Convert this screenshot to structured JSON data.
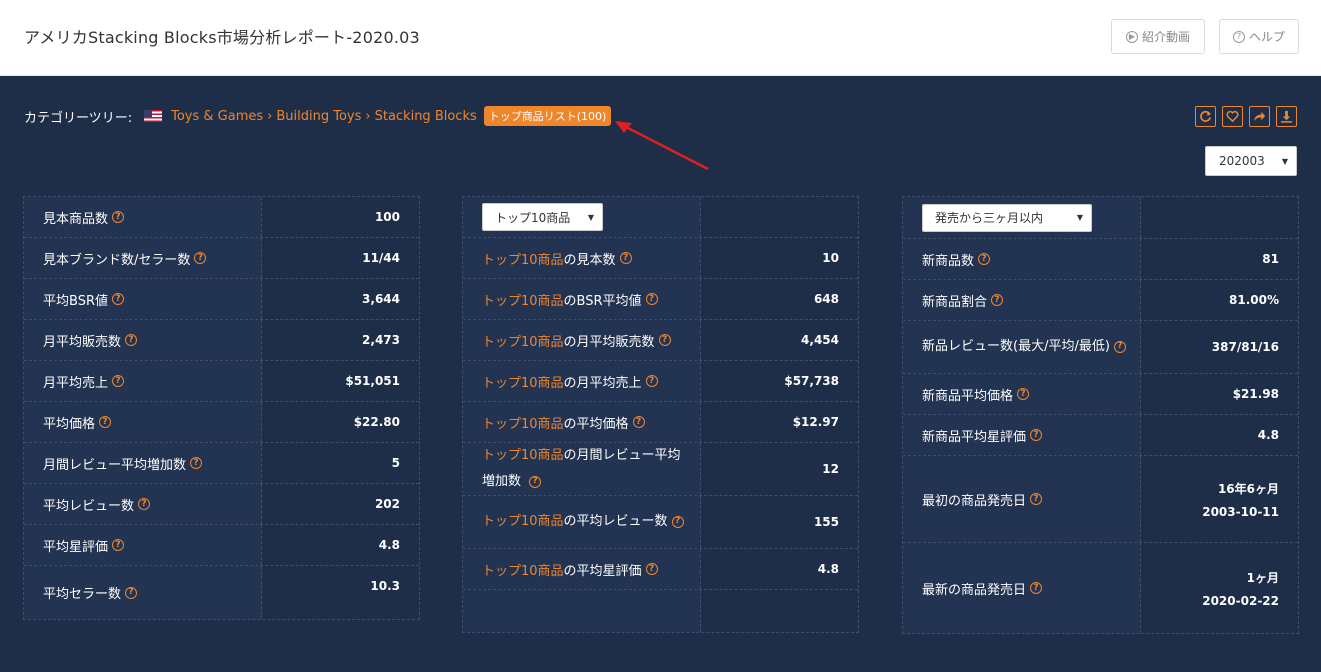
{
  "header": {
    "title": "アメリカStacking Blocks市場分析レポート-2020.03",
    "video_label": "紹介動画",
    "help_label": "ヘルプ"
  },
  "breadcrumb": {
    "label": "カテゴリーツリー:",
    "items": [
      "Toys & Games",
      "Building Toys",
      "Stacking Blocks"
    ],
    "separator": "›",
    "badge": "トップ商品リスト(100)"
  },
  "period": {
    "selected": "202003"
  },
  "tools": [
    "refresh-icon",
    "heart-icon",
    "share-icon",
    "download-icon"
  ],
  "colors": {
    "accent": "#f0862c",
    "panel": "#1e2d48",
    "arrow": "#e02020"
  },
  "left_table": {
    "rows": [
      {
        "label": "見本商品数",
        "value": "100"
      },
      {
        "label": "見本ブランド数/セラー数",
        "value": "11/44"
      },
      {
        "label": "平均BSR値",
        "value": "3,644"
      },
      {
        "label": "月平均販売数",
        "value": "2,473"
      },
      {
        "label": "月平均売上",
        "value": "$51,051"
      },
      {
        "label": "平均価格",
        "value": "$22.80"
      },
      {
        "label": "月間レビュー平均増加数 ",
        "value": "5"
      },
      {
        "label": "平均レビュー数 ",
        "value": "202"
      },
      {
        "label": "平均星評価",
        "value": "4.8"
      },
      {
        "label": "平均セラー数",
        "value": "10.3"
      }
    ]
  },
  "middle_table": {
    "dropdown": "トップ10商品",
    "prefix": "トップ10商品",
    "rows": [
      {
        "suffix": "の見本数",
        "value": "10"
      },
      {
        "suffix": "のBSR平均値",
        "value": "648"
      },
      {
        "suffix": "の月平均販売数",
        "value": "4,454"
      },
      {
        "suffix": "の月平均売上",
        "value": "$57,738"
      },
      {
        "suffix": "の平均価格",
        "value": "$12.97"
      },
      {
        "suffix": "の月間レビュー平均増加数 ",
        "value": "12"
      },
      {
        "suffix": "の平均レビュー数",
        "value": "155"
      },
      {
        "suffix": "の平均星評価",
        "value": "4.8"
      }
    ]
  },
  "right_table": {
    "dropdown": "発売から三ヶ月以内",
    "rows": [
      {
        "label": "新商品数",
        "value": "81"
      },
      {
        "label": "新商品割合",
        "value": "81.00%"
      },
      {
        "label": "新品レビュー数(最大/平均/最低)",
        "value": "387/81/16"
      },
      {
        "label": "新商品平均価格",
        "value": "$21.98"
      },
      {
        "label": "新商品平均星評価",
        "value": "4.8"
      },
      {
        "label": "最初の商品発売日",
        "value_line1": "16年6ヶ月",
        "value_line2": "2003-10-11"
      },
      {
        "label": "最新の商品発売日",
        "value_line1": "1ヶ月",
        "value_line2": "2020-02-22"
      }
    ]
  }
}
